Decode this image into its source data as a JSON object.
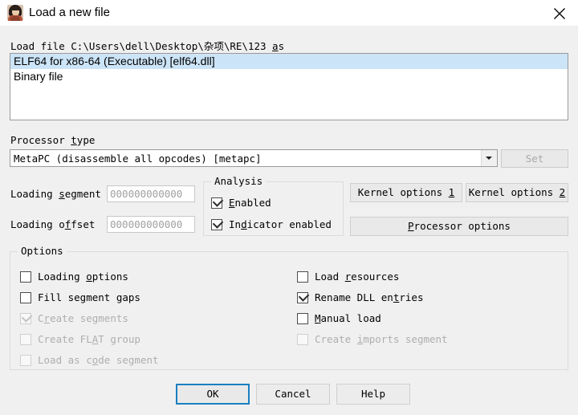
{
  "window": {
    "title": "Load a new file",
    "icon": "user-avatar-icon",
    "close_label": "✕"
  },
  "load_file": {
    "prefix": "Load file ",
    "path": "C:\\Users\\dell\\Desktop\\杂项\\RE\\123",
    "suffix_mnemonic": "a",
    "suffix_rest": "s"
  },
  "format_list": {
    "items": [
      {
        "label": "ELF64 for x86-64 (Executable) [elf64.dll]",
        "selected": true
      },
      {
        "label": "Binary file",
        "selected": false
      }
    ],
    "selection_color": "#cce4f7"
  },
  "processor": {
    "label_mnemonic_pre": "Processor ",
    "label_mnemonic": "t",
    "label_mnemonic_post": "ype",
    "value": "MetaPC (disassemble all opcodes) [metapc]",
    "dropdown_icon": "chevron-down-icon",
    "set_label": "Set",
    "set_enabled": false
  },
  "loading": {
    "segment_label_pre": "Loading ",
    "segment_label_mnemonic": "s",
    "segment_label_post": "egment",
    "segment_value": "000000000000",
    "offset_label_pre": "Loading o",
    "offset_label_mnemonic": "f",
    "offset_label_post": "fset",
    "offset_value": "000000000000"
  },
  "analysis": {
    "title": "Analysis",
    "items": [
      {
        "pre": "",
        "mnemonic": "E",
        "post": "nabled",
        "checked": true,
        "enabled": true
      },
      {
        "pre": "In",
        "mnemonic": "d",
        "post": "icator enabled",
        "checked": true,
        "enabled": true
      }
    ]
  },
  "side_buttons": {
    "kernel_options_1": {
      "pre": "Kernel options ",
      "mnemonic": "1",
      "post": ""
    },
    "kernel_options_2": {
      "pre": "Kernel options ",
      "mnemonic": "2",
      "post": ""
    },
    "processor_options": {
      "pre": "",
      "mnemonic": "P",
      "post": "rocessor options"
    }
  },
  "options": {
    "title": "Options",
    "left_column": [
      {
        "pre": "Loading ",
        "mnemonic": "o",
        "post": "ptions",
        "checked": false,
        "enabled": true
      },
      {
        "pre": "Fill segment gaps",
        "mnemonic": "",
        "post": "",
        "checked": false,
        "enabled": true
      },
      {
        "pre": "C",
        "mnemonic": "r",
        "post": "eate segments",
        "checked": true,
        "enabled": false
      },
      {
        "pre": "Create FL",
        "mnemonic": "A",
        "post": "T group",
        "checked": false,
        "enabled": false
      },
      {
        "pre": "Load as c",
        "mnemonic": "o",
        "post": "de segment",
        "checked": false,
        "enabled": false
      }
    ],
    "right_column": [
      {
        "pre": "Load ",
        "mnemonic": "r",
        "post": "esources",
        "checked": false,
        "enabled": true
      },
      {
        "pre": "Rename DLL en",
        "mnemonic": "t",
        "post": "ries",
        "checked": true,
        "enabled": true
      },
      {
        "pre": "",
        "mnemonic": "M",
        "post": "anual load",
        "checked": false,
        "enabled": true
      },
      {
        "pre": "Create ",
        "mnemonic": "i",
        "post": "mports segment",
        "checked": false,
        "enabled": false
      }
    ]
  },
  "footer": {
    "ok_label": "OK",
    "cancel_label": "Cancel",
    "help_label": "Help",
    "focus_color": "#1a7fc1"
  }
}
